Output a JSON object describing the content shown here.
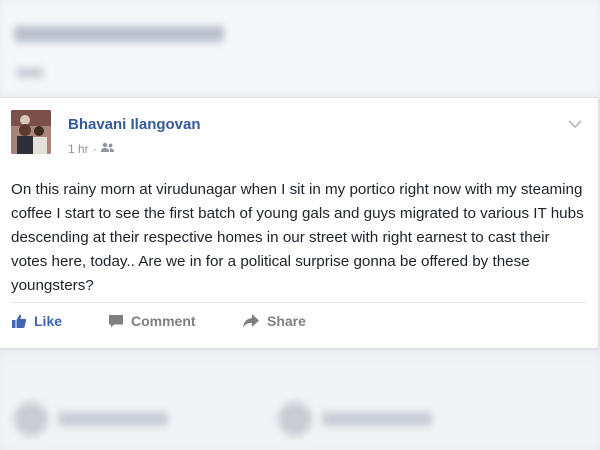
{
  "post": {
    "author": "Bhavani Ilangovan",
    "time": "1 hr",
    "separator": "·",
    "audience_icon": "friends-icon",
    "text": "On this rainy morn at virudunagar when I sit in my portico right now with my steaming coffee I start to see the first batch of young gals and guys migrated to various IT hubs descending at their respective homes in our street with right earnest to cast their votes here, today.. Are we in for a political surprise gonna be offered by these youngsters?"
  },
  "actions": {
    "like": "Like",
    "comment": "Comment",
    "share": "Share"
  },
  "icons": {
    "like": "thumbs-up-icon",
    "comment": "comment-icon",
    "share": "share-arrow-icon",
    "menu": "chevron-down-icon"
  },
  "colors": {
    "author": "#365899",
    "like": "#4267b2",
    "action": "#7f7f7f",
    "text": "#1d2129",
    "meta": "#90949c"
  }
}
